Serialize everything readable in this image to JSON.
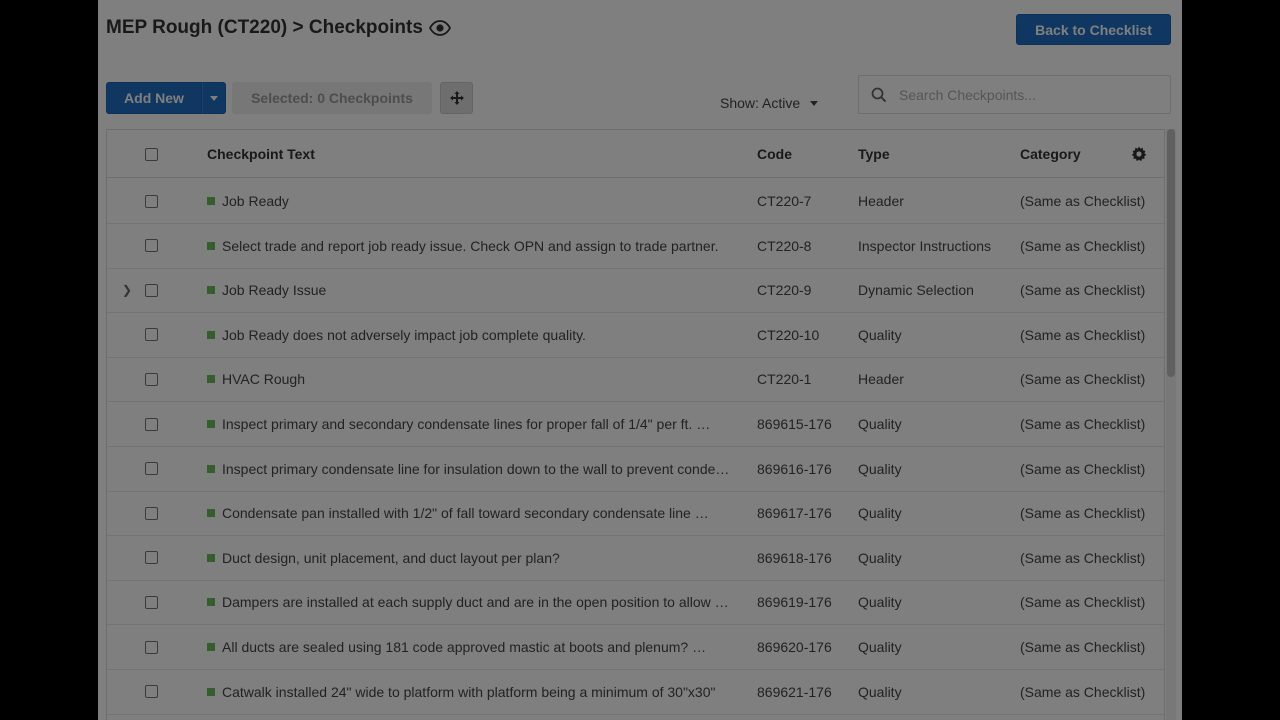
{
  "header": {
    "title": "MEP Rough (CT220) > Checkpoints",
    "back_button": "Back to Checklist"
  },
  "toolbar": {
    "add_new": "Add New",
    "selected": "Selected: 0 Checkpoints",
    "show_filter": "Show: Active",
    "search_placeholder": "Search Checkpoints..."
  },
  "grid": {
    "columns": {
      "text": "Checkpoint Text",
      "code": "Code",
      "type": "Type",
      "category": "Category"
    },
    "rows": [
      {
        "text": "Job Ready",
        "code": "CT220-7",
        "type": "Header",
        "category": "(Same as Checklist)",
        "expandable": false
      },
      {
        "text": "Select trade and report job ready issue. Check OPN and assign to trade partner.",
        "code": "CT220-8",
        "type": "Inspector Instructions",
        "category": "(Same as Checklist)",
        "expandable": false
      },
      {
        "text": "Job Ready Issue",
        "code": "CT220-9",
        "type": "Dynamic Selection",
        "category": "(Same as Checklist)",
        "expandable": true
      },
      {
        "text": "Job Ready does not adversely impact job complete quality.",
        "code": "CT220-10",
        "type": "Quality",
        "category": "(Same as Checklist)",
        "expandable": false
      },
      {
        "text": "HVAC Rough",
        "code": "CT220-1",
        "type": "Header",
        "category": "(Same as Checklist)",
        "expandable": false
      },
      {
        "text": "Inspect primary and secondary condensate lines for proper fall of 1/4\" per ft. …",
        "code": "869615-176",
        "type": "Quality",
        "category": "(Same as Checklist)",
        "expandable": false
      },
      {
        "text": "Inspect primary condensate line for insulation down to the wall to prevent condensation",
        "code": "869616-176",
        "type": "Quality",
        "category": "(Same as Checklist)",
        "expandable": false
      },
      {
        "text": "Condensate pan installed with 1/2\" of fall toward secondary condensate line …",
        "code": "869617-176",
        "type": "Quality",
        "category": "(Same as Checklist)",
        "expandable": false
      },
      {
        "text": "Duct design, unit placement, and duct layout per plan?",
        "code": "869618-176",
        "type": "Quality",
        "category": "(Same as Checklist)",
        "expandable": false
      },
      {
        "text": "Dampers are installed at each supply duct and are in the open position to allow airflow",
        "code": "869619-176",
        "type": "Quality",
        "category": "(Same as Checklist)",
        "expandable": false
      },
      {
        "text": "All ducts are sealed using 181 code approved mastic at boots and plenum? …",
        "code": "869620-176",
        "type": "Quality",
        "category": "(Same as Checklist)",
        "expandable": false
      },
      {
        "text": "Catwalk installed 24\" wide to platform with platform being a minimum of 30\"x30\"",
        "code": "869621-176",
        "type": "Quality",
        "category": "(Same as Checklist)",
        "expandable": false
      }
    ]
  },
  "colors": {
    "primary": "#1e6fc2",
    "status_green": "#6cbb5a",
    "backdrop": "#000000"
  },
  "icons": [
    "eye-icon",
    "caret-down-icon",
    "move-icon",
    "search-icon",
    "gear-icon",
    "chevron-right-icon"
  ]
}
